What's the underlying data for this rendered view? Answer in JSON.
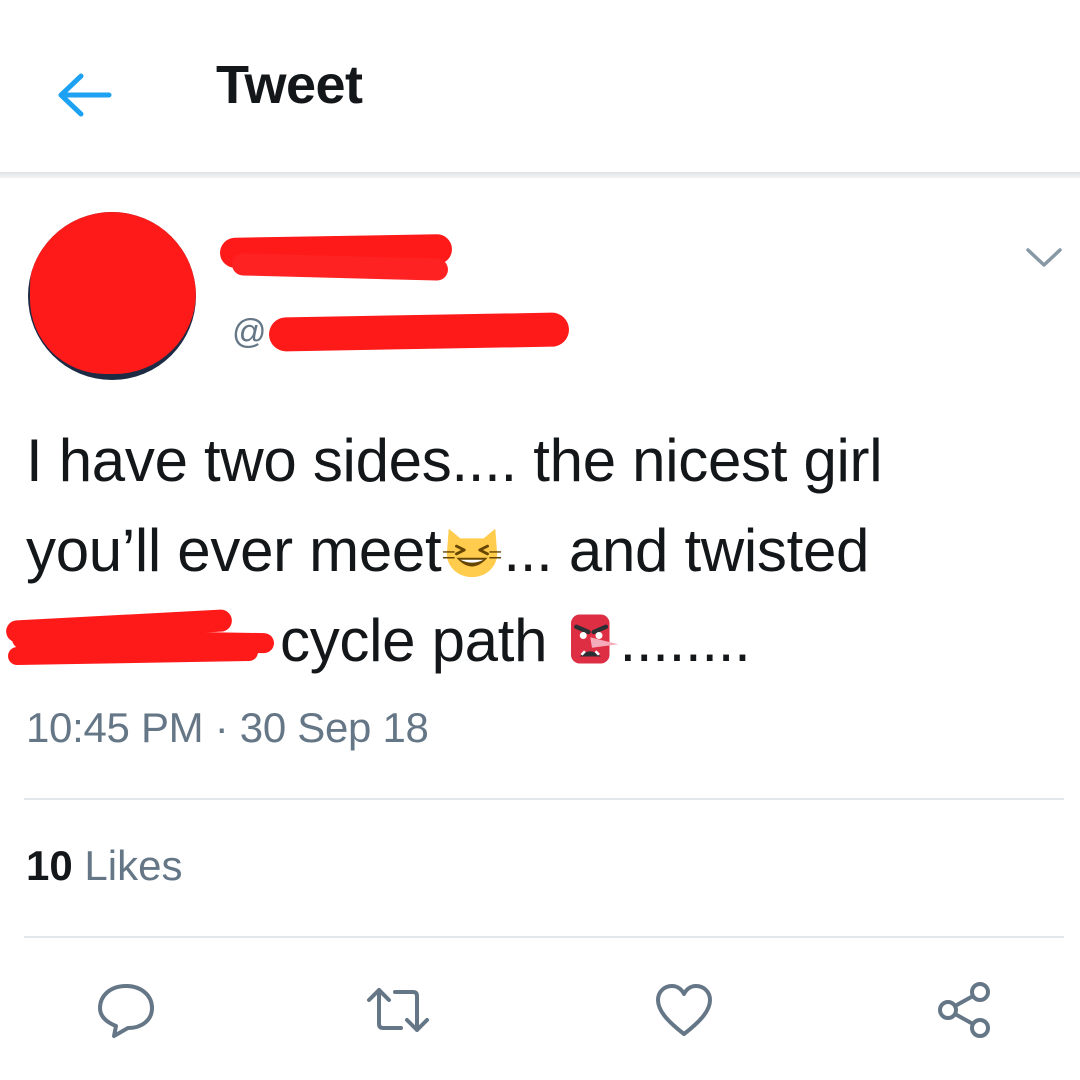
{
  "header": {
    "title": "Tweet",
    "back_icon": "arrow-left-icon"
  },
  "author": {
    "handle_prefix": "@"
  },
  "tweet": {
    "line1": "I have two sides.... the nicest girl",
    "line2_before": "you’ll ever meet",
    "line2_after": "... and twisted",
    "line3_before": "cycle path ",
    "line3_after": "........",
    "emoji_1": "grinning-cat-squinting-eyes-icon",
    "emoji_2": "goblin-mask-icon"
  },
  "timestamp": "10:45 PM · 30 Sep 18",
  "likes": {
    "count": "10",
    "label": "Likes"
  },
  "actions": [
    "reply-icon",
    "retweet-icon",
    "like-icon",
    "share-icon"
  ],
  "colors": {
    "accent": "#1da1f2",
    "secondary_text": "#657786",
    "redaction": "#ff1a1a"
  }
}
